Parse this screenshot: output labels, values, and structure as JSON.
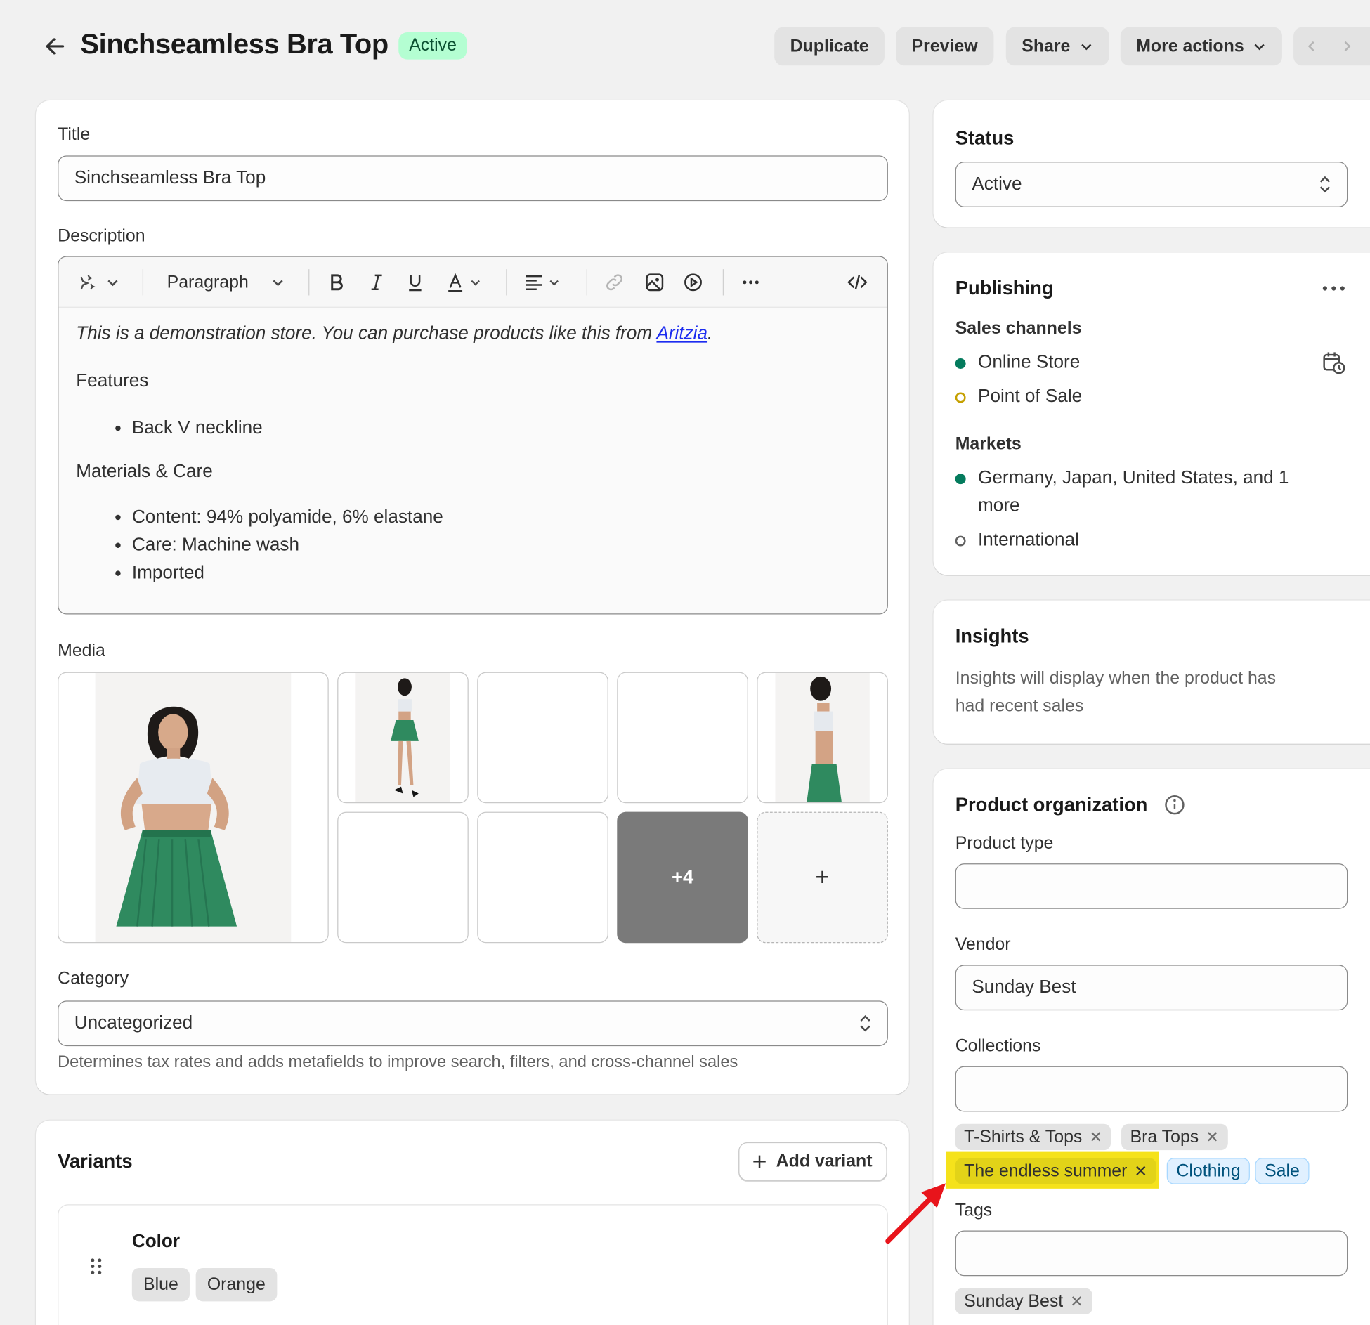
{
  "header": {
    "title": "Sinchseamless Bra Top",
    "status_badge": "Active",
    "duplicate": "Duplicate",
    "preview": "Preview",
    "share": "Share",
    "more_actions": "More actions"
  },
  "main": {
    "title_label": "Title",
    "title_value": "Sinchseamless Bra Top",
    "description_label": "Description",
    "toolbar_style": "Paragraph",
    "description": {
      "intro": "This is a demonstration store. You can purchase products like this from ",
      "intro_link": "Aritzia",
      "intro_end": ".",
      "features_heading": "Features",
      "features": [
        "Back V neckline"
      ],
      "materials_heading": "Materials & Care",
      "materials": [
        "Content: 94% polyamide, 6% elastane",
        "Care: Machine wash",
        "Imported"
      ]
    },
    "media_label": "Media",
    "media_more": "+4",
    "media_add": "+",
    "category_label": "Category",
    "category_value": "Uncategorized",
    "category_help": "Determines tax rates and adds metafields to improve search, filters, and cross-channel sales"
  },
  "variants": {
    "title": "Variants",
    "add_variant": "Add variant",
    "option_name": "Color",
    "values": [
      "Blue",
      "Orange"
    ]
  },
  "sidebar": {
    "status_title": "Status",
    "status_value": "Active",
    "publishing_title": "Publishing",
    "sales_channels_label": "Sales channels",
    "channels": [
      "Online Store",
      "Point of Sale"
    ],
    "markets_label": "Markets",
    "markets": [
      "Germany, Japan, United States, and 1",
      "more",
      "International"
    ],
    "insights_title": "Insights",
    "insights_text_1": "Insights will display when the product has",
    "insights_text_2": "had recent sales",
    "org_title": "Product organization",
    "product_type_label": "Product type",
    "product_type_value": "",
    "vendor_label": "Vendor",
    "vendor_value": "Sunday Best",
    "collections_label": "Collections",
    "collections": [
      "T-Shirts & Tops",
      "Bra Tops",
      "The endless summer"
    ],
    "suggested_collections": [
      "Clothing",
      "Sale"
    ],
    "tags_label": "Tags",
    "tags": [
      "Sunday Best"
    ]
  },
  "colors": {
    "active_badge_bg": "#b4fed2",
    "online_dot": "#047b5d",
    "pos_dot": "#c5a000",
    "highlight": "#f5e21b",
    "arrow": "#e8141b"
  }
}
